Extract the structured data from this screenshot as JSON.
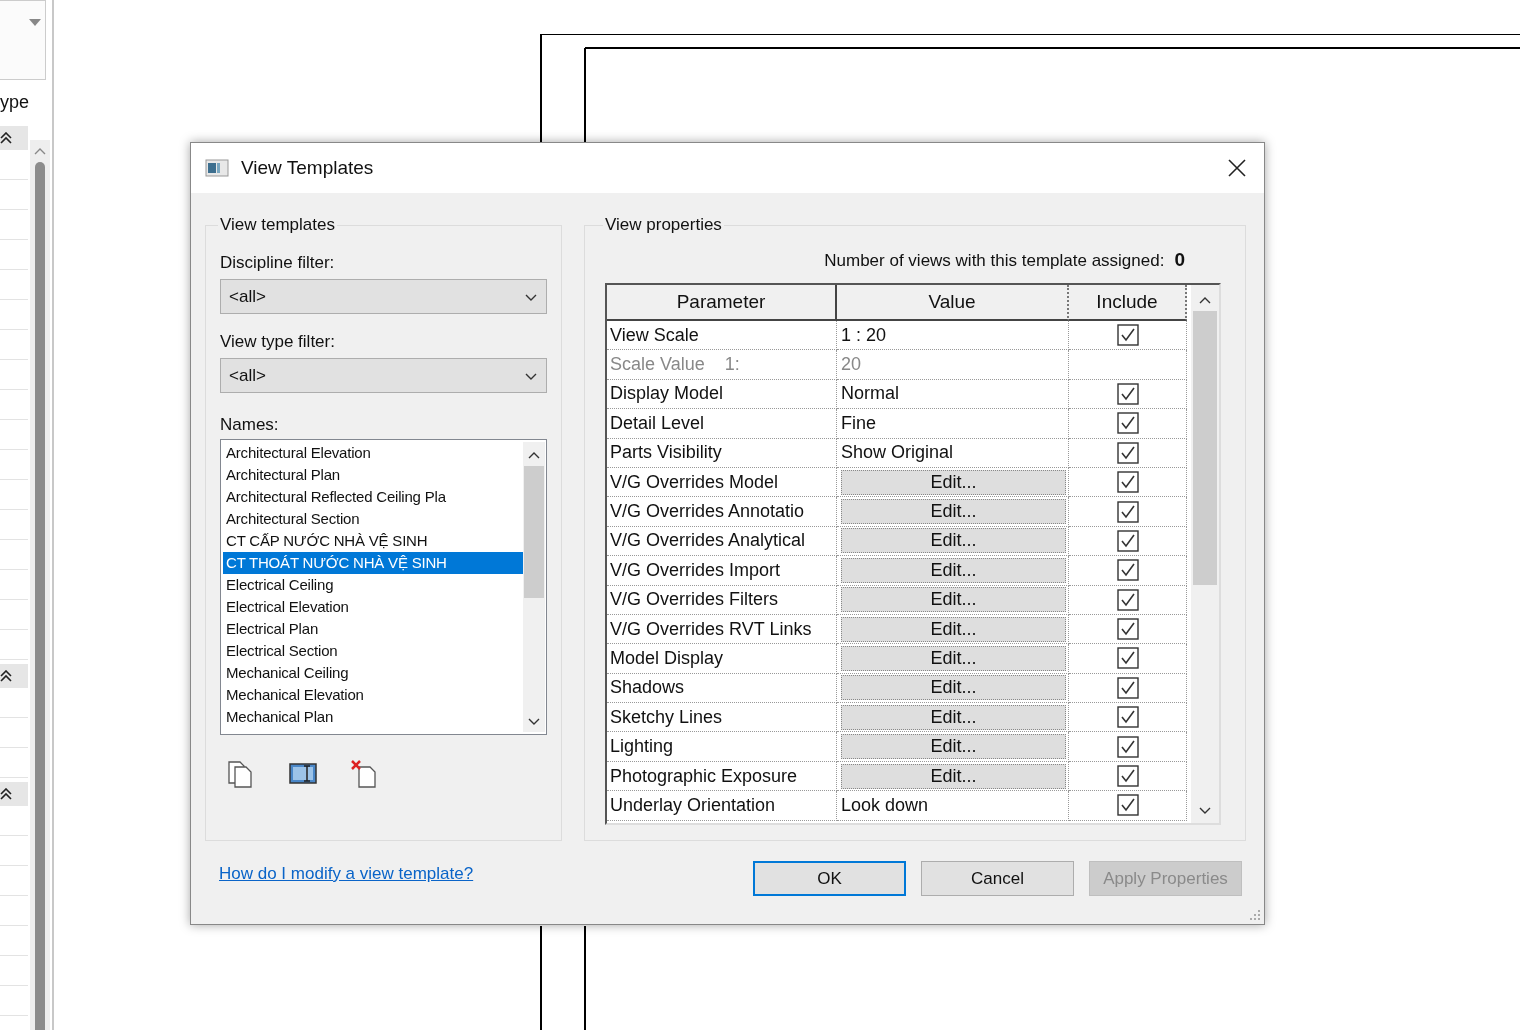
{
  "side_panel": {
    "label": "ype"
  },
  "dialog": {
    "title": "View Templates",
    "templates": {
      "title": "View templates",
      "discipline_filter": {
        "label": "Discipline filter:",
        "value": "<all>"
      },
      "view_type_filter": {
        "label": "View type filter:",
        "value": "<all>"
      },
      "names": {
        "label": "Names:",
        "items": [
          {
            "text": "Architectural Elevation",
            "selected": false
          },
          {
            "text": "Architectural Plan",
            "selected": false
          },
          {
            "text": "Architectural Reflected Ceiling Pla",
            "selected": false
          },
          {
            "text": "Architectural Section",
            "selected": false
          },
          {
            "text": "CT CẤP NƯỚC NHÀ VỆ SINH",
            "selected": false
          },
          {
            "text": "CT THOÁT NƯỚC NHÀ VỆ SINH",
            "selected": true
          },
          {
            "text": "Electrical Ceiling",
            "selected": false
          },
          {
            "text": "Electrical Elevation",
            "selected": false
          },
          {
            "text": "Electrical Plan",
            "selected": false
          },
          {
            "text": "Electrical Section",
            "selected": false
          },
          {
            "text": "Mechanical Ceiling",
            "selected": false
          },
          {
            "text": "Mechanical Elevation",
            "selected": false
          },
          {
            "text": "Mechanical Plan",
            "selected": false
          }
        ]
      }
    },
    "properties": {
      "title": "View properties",
      "assigned_label": "Number of views with this template assigned:",
      "assigned_count": "0",
      "table": {
        "columns": [
          "Parameter",
          "Value",
          "Include"
        ],
        "rows": [
          {
            "parameter": "View Scale",
            "value": "1 : 20",
            "kind": "text",
            "include": true
          },
          {
            "parameter": "Scale Value",
            "parameter_suffix": "1:",
            "value": "20",
            "kind": "readonly"
          },
          {
            "parameter": "Display Model",
            "value": "Normal",
            "kind": "text",
            "include": true
          },
          {
            "parameter": "Detail Level",
            "value": "Fine",
            "kind": "text",
            "include": true
          },
          {
            "parameter": "Parts Visibility",
            "value": "Show Original",
            "kind": "text",
            "include": true
          },
          {
            "parameter": "V/G Overrides Model",
            "value": "Edit...",
            "kind": "button",
            "include": true
          },
          {
            "parameter": "V/G Overrides Annotatio",
            "value": "Edit...",
            "kind": "button",
            "include": true
          },
          {
            "parameter": "V/G Overrides Analytical",
            "value": "Edit...",
            "kind": "button",
            "include": true
          },
          {
            "parameter": "V/G Overrides Import",
            "value": "Edit...",
            "kind": "button",
            "include": true
          },
          {
            "parameter": "V/G Overrides Filters",
            "value": "Edit...",
            "kind": "button",
            "include": true
          },
          {
            "parameter": "V/G Overrides RVT Links",
            "value": "Edit...",
            "kind": "button",
            "include": true
          },
          {
            "parameter": "Model Display",
            "value": "Edit...",
            "kind": "button",
            "include": true
          },
          {
            "parameter": "Shadows",
            "value": "Edit...",
            "kind": "button",
            "include": true
          },
          {
            "parameter": "Sketchy Lines",
            "value": "Edit...",
            "kind": "button",
            "include": true
          },
          {
            "parameter": "Lighting",
            "value": "Edit...",
            "kind": "button",
            "include": true
          },
          {
            "parameter": "Photographic Exposure",
            "value": "Edit...",
            "kind": "button",
            "include": true
          },
          {
            "parameter": "Underlay Orientation",
            "value": "Look down",
            "kind": "text",
            "include": true
          }
        ]
      }
    },
    "help_link": "How do I modify a view template?",
    "buttons": [
      {
        "label": "OK",
        "kind": "default"
      },
      {
        "label": "Cancel",
        "kind": "normal"
      },
      {
        "label": "Apply Properties",
        "kind": "disabled"
      }
    ]
  }
}
